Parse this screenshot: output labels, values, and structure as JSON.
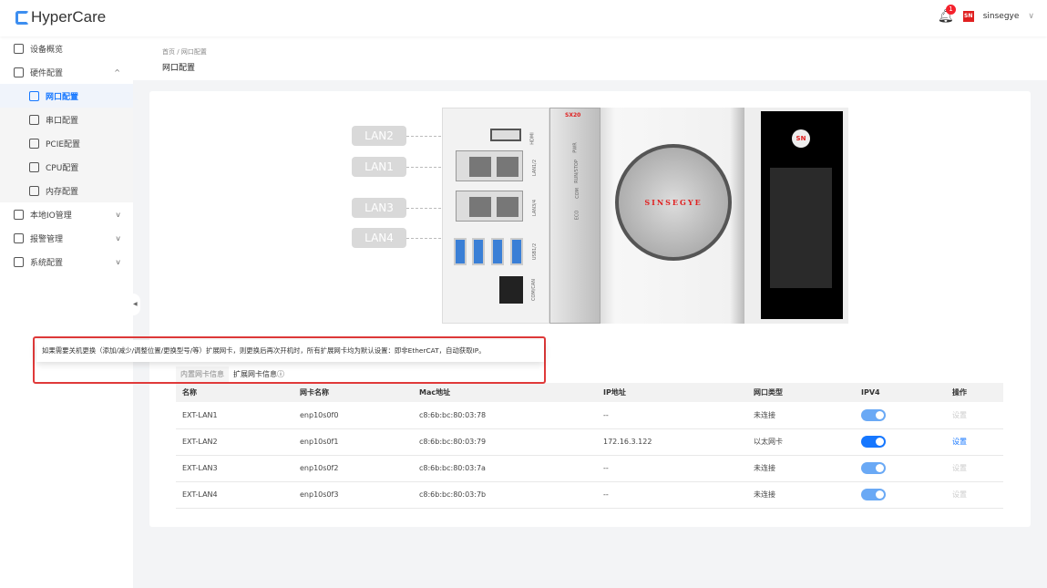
{
  "header": {
    "app_name": "HyperCare",
    "notification_count": "1",
    "username": "sinsegye",
    "user_logo": "SN"
  },
  "sidebar": {
    "items": [
      {
        "label": "设备概览"
      },
      {
        "label": "硬件配置",
        "expanded": true,
        "children": [
          {
            "label": "网口配置",
            "active": true
          },
          {
            "label": "串口配置"
          },
          {
            "label": "PCIE配置"
          },
          {
            "label": "CPU配置"
          },
          {
            "label": "内存配置"
          }
        ]
      },
      {
        "label": "本地IO管理"
      },
      {
        "label": "报警管理"
      },
      {
        "label": "系统配置"
      }
    ]
  },
  "breadcrumb": {
    "home": "首页",
    "sep": "/",
    "current": "网口配置"
  },
  "page_title": "网口配置",
  "device": {
    "model": "SX20",
    "brand": "SINSEGYE",
    "brand_logo": "SN",
    "lan_labels": [
      "LAN2",
      "LAN1",
      "LAN3",
      "LAN4"
    ],
    "port_labels": [
      "HDMI",
      "LAN1/2",
      "LAN3/4",
      "USB1/2",
      "COM/CAN"
    ],
    "led_labels": [
      "PWR",
      "RUN/STOP",
      "COM",
      "ECO"
    ]
  },
  "tooltip": "如果需要关机更换（添加/减少/调整位置/更换型号/等）扩展网卡，则更换后再次开机时，所有扩展网卡均为默认设置：即非EtherCAT，自动获取IP。",
  "tabs": [
    {
      "label": "内置网卡信息"
    },
    {
      "label": "扩展网卡信息ⓘ",
      "active": true
    }
  ],
  "table": {
    "columns": [
      "名称",
      "网卡名称",
      "Mac地址",
      "IP地址",
      "网口类型",
      "IPV4",
      "操作"
    ],
    "rows": [
      {
        "name": "EXT-LAN1",
        "nic": "enp10s0f0",
        "mac": "c8:6b:bc:80:03:78",
        "ip": "--",
        "type": "未连接",
        "ipv4": true,
        "action": "设置",
        "action_enabled": false
      },
      {
        "name": "EXT-LAN2",
        "nic": "enp10s0f1",
        "mac": "c8:6b:bc:80:03:79",
        "ip": "172.16.3.122",
        "type": "以太网卡",
        "ipv4": true,
        "action": "设置",
        "action_enabled": true
      },
      {
        "name": "EXT-LAN3",
        "nic": "enp10s0f2",
        "mac": "c8:6b:bc:80:03:7a",
        "ip": "--",
        "type": "未连接",
        "ipv4": true,
        "action": "设置",
        "action_enabled": false
      },
      {
        "name": "EXT-LAN4",
        "nic": "enp10s0f3",
        "mac": "c8:6b:bc:80:03:7b",
        "ip": "--",
        "type": "未连接",
        "ipv4": true,
        "action": "设置",
        "action_enabled": false
      }
    ]
  }
}
